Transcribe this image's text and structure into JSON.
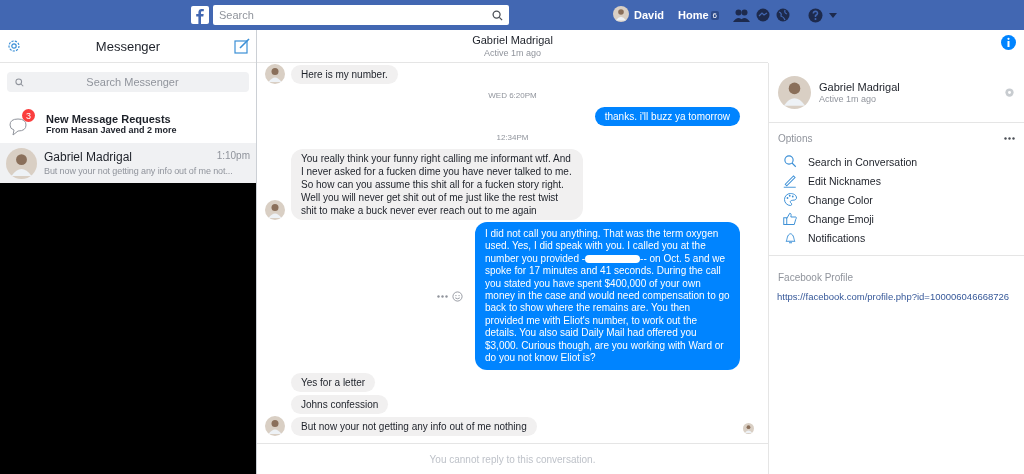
{
  "topbar": {
    "search_placeholder": "Search",
    "user": "David",
    "home": "Home",
    "home_badge": "6"
  },
  "sidebar": {
    "title": "Messenger",
    "search_placeholder": "Search Messenger",
    "requests": {
      "title": "New Message Requests",
      "subtitle": "From Hasan Javed and 2 more",
      "badge": "3"
    },
    "conversations": [
      {
        "name": "Gabriel Madrigal",
        "time": "1:10pm",
        "preview": "But now your not getting any info out of me not...",
        "selected": true
      }
    ]
  },
  "chat": {
    "title": "Gabriel Madrigal",
    "status": "Active 1m ago",
    "messages": [
      {
        "kind": "incoming",
        "text": "Here is my number.",
        "show_avatar": true
      },
      {
        "kind": "timestamp",
        "text": "WED 6:20PM"
      },
      {
        "kind": "outgoing",
        "text": "thanks. i'll buzz ya tomorrow"
      },
      {
        "kind": "timestamp",
        "text": "12:34PM"
      },
      {
        "kind": "incoming",
        "text": "You really think your funny right calling me informant wtf. And I never asked for a fucken dime you have never talked to me. So how can you assume this shit all for a fucken story right. Well you will never get shit out of me  just like the rest twist shit to make a buck  never ever reach out to me again",
        "show_avatar": true
      },
      {
        "kind": "redacted",
        "text": "I did not call you anything. That was the term oxygen used. Yes, I did speak with you. I called you at the number you provided -",
        "text_after": "-- on Oct. 5 and we spoke for 17 minutes and 41 seconds. During the call you stated you have spent $400,000 of your own money in the case and would need compensation to go back to show where the remains are. You then provided me with Eliot's number, to work out the details. You also said Daily Mail had offered you $3,000. Curious though, are you working with Ward or do you not know Eliot is?",
        "hover_actions": true
      },
      {
        "kind": "incoming",
        "text": "Yes for a letter",
        "show_avatar": false
      },
      {
        "kind": "incoming",
        "text": "Johns confession",
        "show_avatar": false
      },
      {
        "kind": "incoming",
        "text": "But now your not getting any info out of me nothing",
        "show_avatar": true,
        "seen": true
      }
    ],
    "footer": "You cannot reply to this conversation."
  },
  "details": {
    "name": "Gabriel Madrigal",
    "status": "Active 1m ago",
    "options_label": "Options",
    "options": [
      {
        "kind": "search",
        "label": "Search in Conversation"
      },
      {
        "kind": "nicknames",
        "label": "Edit Nicknames"
      },
      {
        "kind": "color",
        "label": "Change Color"
      },
      {
        "kind": "emoji",
        "label": "Change Emoji"
      },
      {
        "kind": "notifications",
        "label": "Notifications"
      }
    ],
    "profile_label": "Facebook Profile",
    "profile_link": "https://facebook.com/profile.php?id=100006046668726"
  }
}
